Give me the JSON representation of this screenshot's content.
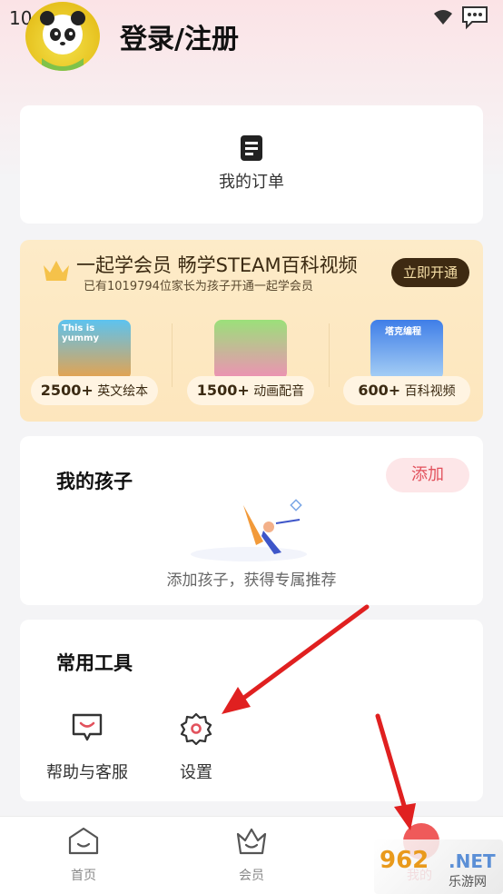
{
  "status": {
    "time": "10:45"
  },
  "header": {
    "title": "登录/注册"
  },
  "order": {
    "label": "我的订单"
  },
  "vip": {
    "title": "一起学会员 畅学STEAM百科视频",
    "subtitle": "已有1019794位家长为孩子开通一起学会员",
    "cta": "立即开通",
    "items": [
      {
        "count": "2500+",
        "label": "英文绘本",
        "thumb_text": "This is yummy"
      },
      {
        "count": "1500+",
        "label": "动画配音",
        "thumb_text": ""
      },
      {
        "count": "600+",
        "label": "百科视频",
        "thumb_text": "塔克编程"
      }
    ]
  },
  "children": {
    "title": "我的孩子",
    "add_label": "添加",
    "tip": "添加孩子，获得专属推荐"
  },
  "tools": {
    "title": "常用工具",
    "items": [
      {
        "label": "帮助与客服",
        "icon": "help-message-icon"
      },
      {
        "label": "设置",
        "icon": "gear-icon"
      }
    ]
  },
  "tabbar": {
    "items": [
      {
        "label": "首页",
        "icon": "home-icon"
      },
      {
        "label": "会员",
        "icon": "crown-icon"
      },
      {
        "label": "我的",
        "icon": "profile-icon"
      }
    ]
  },
  "watermark": {
    "main": "962",
    "net": ".NET",
    "sub": "乐游网"
  },
  "colors": {
    "accent": "#e2525d",
    "arrow": "#e02020",
    "vip_bg": "#fde6bd",
    "vip_button": "#3e2a12"
  }
}
